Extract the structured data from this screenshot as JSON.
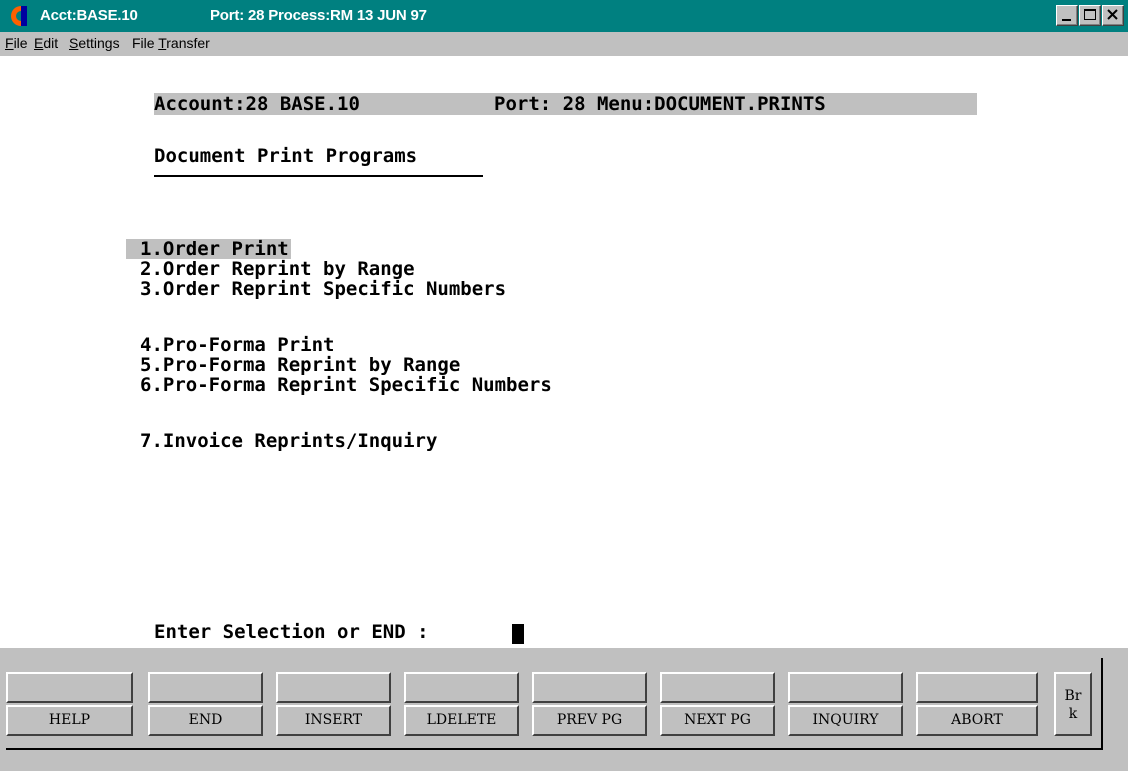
{
  "window": {
    "title_account": "Acct:BASE.10",
    "title_port": "Port: 28 Process:RM 13 JUN 97",
    "titlebar_color": "#008080"
  },
  "menubar": {
    "items": [
      {
        "label": "File",
        "key": "F",
        "rest": "ile"
      },
      {
        "label": "Edit",
        "key": "E",
        "rest": "dit"
      },
      {
        "label": "Settings",
        "key": "S",
        "rest": "ettings"
      },
      {
        "label": "File Transfer",
        "pre": "File ",
        "key": "T",
        "rest": "ransfer"
      }
    ]
  },
  "terminal": {
    "status_account": "Account:28 BASE.10",
    "status_port_menu": "Port: 28 Menu:DOCUMENT.PRINTS",
    "heading": "Document Print Programs",
    "menu_options": [
      "1.Order Print",
      "2.Order Reprint by Range",
      "3.Order Reprint Specific Numbers",
      "4.Pro-Forma Print",
      "5.Pro-Forma Reprint by Range",
      "6.Pro-Forma Reprint Specific Numbers",
      "7.Invoice Reprints/Inquiry"
    ],
    "prompt": "Enter Selection or END :"
  },
  "function_keys": {
    "top_row": [
      "",
      "",
      "",
      "",
      "",
      "",
      "",
      ""
    ],
    "bottom_row": [
      "HELP",
      "END",
      "INSERT",
      "LDELETE",
      "PREV PG",
      "NEXT PG",
      "INQUIRY",
      "ABORT"
    ],
    "break_key": [
      "Br",
      "k"
    ]
  }
}
